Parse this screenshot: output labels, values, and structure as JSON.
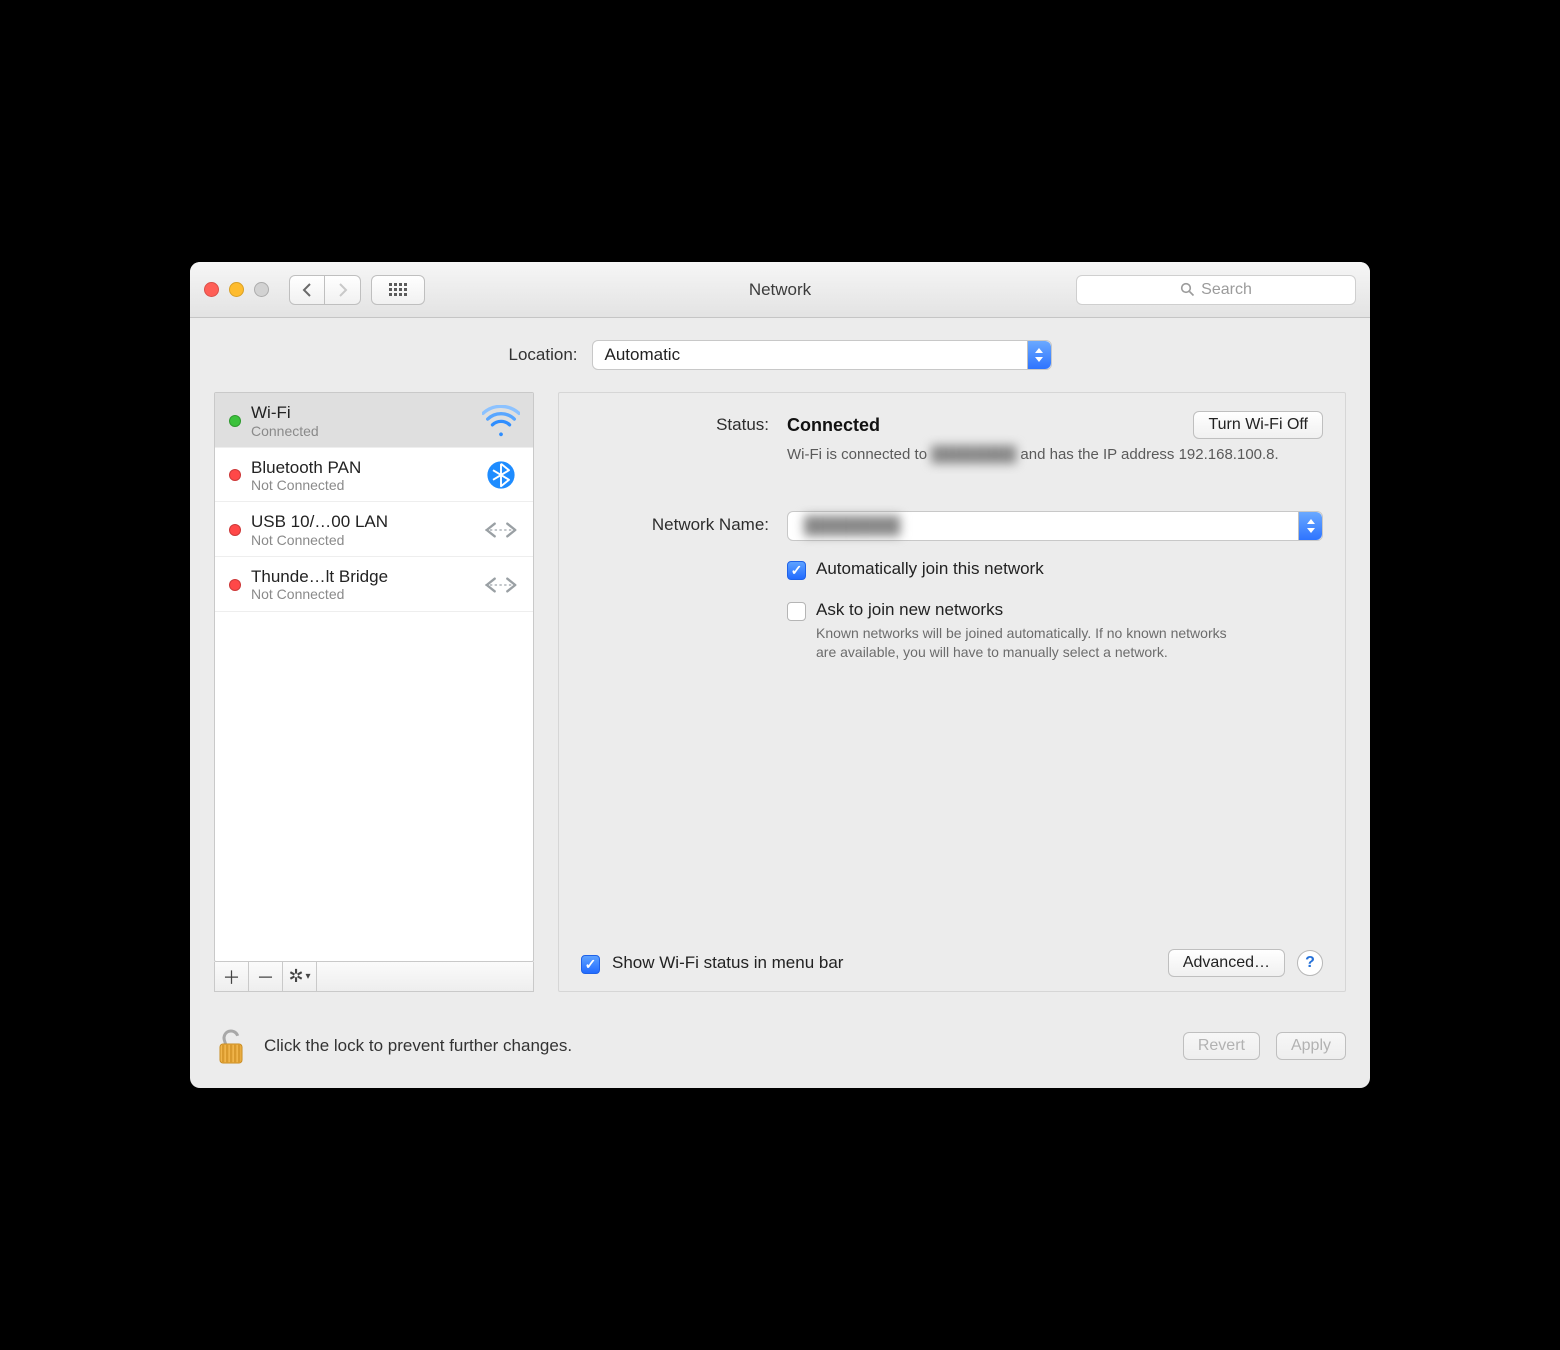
{
  "window": {
    "title": "Network"
  },
  "toolbar": {
    "search_placeholder": "Search"
  },
  "location": {
    "label": "Location:",
    "value": "Automatic"
  },
  "services": [
    {
      "name": "Wi-Fi",
      "status": "Connected",
      "dot": "green",
      "icon": "wifi",
      "selected": true
    },
    {
      "name": "Bluetooth PAN",
      "status": "Not Connected",
      "dot": "red",
      "icon": "bluetooth",
      "selected": false
    },
    {
      "name": "USB 10/…00 LAN",
      "status": "Not Connected",
      "dot": "red",
      "icon": "ethernet",
      "selected": false
    },
    {
      "name": "Thunde…lt Bridge",
      "status": "Not Connected",
      "dot": "red",
      "icon": "ethernet",
      "selected": false
    }
  ],
  "detail": {
    "status_label": "Status:",
    "status_value": "Connected",
    "toggle_button": "Turn Wi-Fi Off",
    "desc_prefix": "Wi-Fi is connected to ",
    "desc_suffix": "and has the IP address 192.168.100.8.",
    "redacted_ssid": "████████",
    "network_name_label": "Network Name:",
    "network_name_value": "████████",
    "auto_join_label": "Automatically join this network",
    "auto_join_checked": true,
    "ask_join_label": "Ask to join new networks",
    "ask_join_checked": false,
    "ask_join_help": "Known networks will be joined automatically. If no known networks are available, you will have to manually select a network.",
    "show_status_label": "Show Wi-Fi status in menu bar",
    "show_status_checked": true,
    "advanced_button": "Advanced…"
  },
  "footer": {
    "lock_text": "Click the lock to prevent further changes.",
    "revert": "Revert",
    "apply": "Apply"
  }
}
